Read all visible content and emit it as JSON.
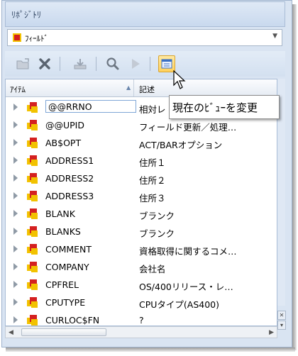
{
  "title": "ﾘﾎﾟｼﾞﾄﾘ",
  "combo": {
    "value": "ﾌｨｰﾙﾄﾞ",
    "icon": "field-icon"
  },
  "toolbar": {
    "buttons": [
      {
        "name": "open-folder-icon"
      },
      {
        "name": "delete-icon"
      },
      {
        "name": "download-icon"
      },
      {
        "name": "search-icon"
      },
      {
        "name": "play-icon"
      },
      {
        "name": "change-view-icon"
      }
    ]
  },
  "grid": {
    "columns": [
      "ｱｲﾃﾑ",
      "記述"
    ],
    "rows": [
      {
        "name": "@@RRNO",
        "desc": "相対レ"
      },
      {
        "name": "@@UPID",
        "desc": "フィールド更新／処理…"
      },
      {
        "name": "AB$OPT",
        "desc": " ACT/BARオプション"
      },
      {
        "name": "ADDRESS1",
        "desc": "住所１"
      },
      {
        "name": "ADDRESS2",
        "desc": "住所２"
      },
      {
        "name": "ADDRESS3",
        "desc": "住所３"
      },
      {
        "name": "BLANK",
        "desc": "ブランク"
      },
      {
        "name": "BLANKS",
        "desc": "ブランク"
      },
      {
        "name": "COMMENT",
        "desc": "資格取得に関するコメ…"
      },
      {
        "name": "COMPANY",
        "desc": "会社名"
      },
      {
        "name": "CPFREL",
        "desc": " OS/400リリース・レ…"
      },
      {
        "name": "CPUTYPE",
        "desc": " CPUタイプ(AS400)"
      },
      {
        "name": "CURLOC$FN",
        "desc": "?"
      }
    ]
  },
  "tooltip": {
    "text": "現在のﾋﾞｭｰを変更"
  },
  "colors": {
    "icon_red": "#d42020",
    "icon_yellow": "#f2c200",
    "selected_btn": "#ffd15c"
  }
}
